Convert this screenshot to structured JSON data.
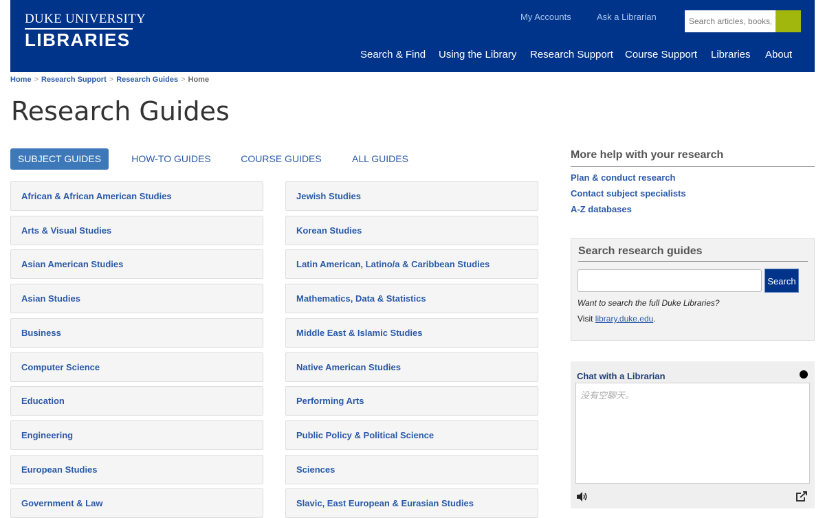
{
  "header": {
    "logo_line1": "DUKE UNIVERSITY",
    "logo_line2": "LIBRARIES",
    "util_links": [
      "My Accounts",
      "Ask a Librarian"
    ],
    "search_placeholder": "Search articles, books, jour",
    "search_button_color": "#a1b70d",
    "nav": [
      "Search & Find",
      "Using the Library",
      "Research Support",
      "Course Support",
      "Libraries",
      "About"
    ]
  },
  "breadcrumb": {
    "items": [
      "Home",
      "Research Support",
      "Research Guides"
    ],
    "separator": ">",
    "current": "Home"
  },
  "page_title": "Research Guides",
  "tabs": [
    "SUBJECT GUIDES",
    "HOW-TO GUIDES",
    "COURSE GUIDES",
    "ALL GUIDES"
  ],
  "active_tab": "SUBJECT GUIDES",
  "guides": {
    "left": [
      "African & African American Studies",
      "Arts & Visual Studies",
      "Asian American Studies",
      "Asian Studies",
      "Business",
      "Computer Science",
      "Education",
      "Engineering",
      "European Studies",
      "Government & Law"
    ],
    "right": [
      "Jewish Studies",
      "Korean Studies",
      "Latin American, Latino/a & Caribbean Studies",
      "Mathematics, Data & Statistics",
      "Middle East & Islamic Studies",
      "Native American Studies",
      "Performing Arts",
      "Public Policy & Political Science",
      "Sciences",
      "Slavic, East European & Eurasian Studies"
    ]
  },
  "more_help": {
    "title": "More help with your research",
    "links": [
      "Plan & conduct research",
      "Contact subject specialists",
      "A-Z databases"
    ]
  },
  "search_guides": {
    "title": "Search research guides",
    "button": "Search",
    "note": "Want to search the full Duke Libraries?",
    "visit_prefix": "Visit ",
    "visit_link": "library.duke.edu",
    "visit_suffix": "."
  },
  "chat": {
    "title": "Chat with a Librarian",
    "placeholder": "没有空聊天。",
    "icons": [
      "speaker-icon",
      "popout-icon"
    ]
  },
  "colors": {
    "header_bg": "#00338a",
    "link": "#2a5aa8",
    "active_tab": "#3d78b8",
    "search_button": "#00338a"
  }
}
